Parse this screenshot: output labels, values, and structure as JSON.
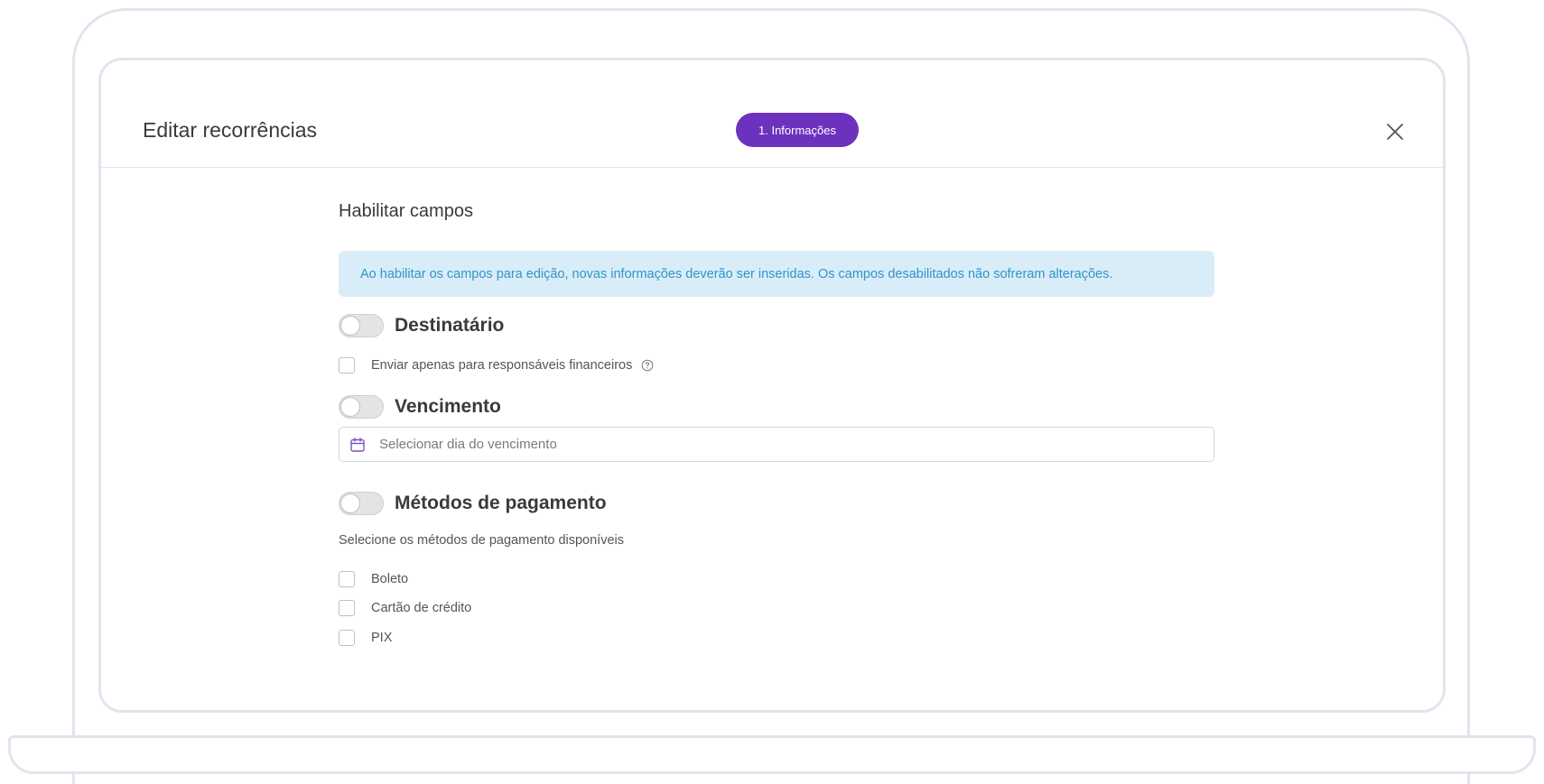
{
  "modal": {
    "title": "Editar recorrências",
    "step_label": "1. Informações"
  },
  "section": {
    "title": "Habilitar campos",
    "info_message": "Ao habilitar os campos para edição, novas informações deverão ser inseridas. Os campos desabilitados não sofreram alterações."
  },
  "destinatario": {
    "label": "Destinatário",
    "enabled": false,
    "checkbox_label": "Enviar apenas para responsáveis financeiros",
    "checked": false
  },
  "vencimento": {
    "label": "Vencimento",
    "enabled": false,
    "placeholder": "Selecionar dia do vencimento"
  },
  "pagamento": {
    "label": "Métodos de pagamento",
    "enabled": false,
    "hint": "Selecione os métodos de pagamento disponíveis",
    "options": [
      {
        "label": "Boleto",
        "checked": false
      },
      {
        "label": "Cartão de crédito",
        "checked": false
      },
      {
        "label": "PIX",
        "checked": false
      }
    ]
  },
  "colors": {
    "accent": "#6c32be",
    "info_bg": "#d9edf8",
    "info_text": "#2f95c9",
    "frame": "#e7e1ef"
  },
  "icons": {
    "close": "close-icon",
    "calendar": "calendar-icon",
    "help": "help-circle-icon"
  }
}
